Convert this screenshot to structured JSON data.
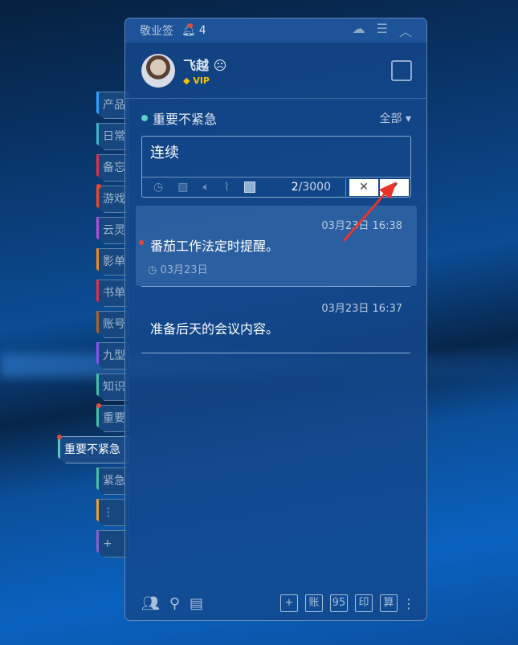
{
  "sidebar": {
    "tabs": [
      {
        "label": "产品",
        "color": "#2fa0ff"
      },
      {
        "label": "日常",
        "color": "#3fb5c7"
      },
      {
        "label": "备忘",
        "color": "#e0304a"
      },
      {
        "label": "游戏",
        "color": "#e84a2a",
        "badge": true
      },
      {
        "label": "云灵",
        "color": "#b050d8"
      },
      {
        "label": "影单",
        "color": "#f08a20"
      },
      {
        "label": "书单",
        "color": "#e0304a"
      },
      {
        "label": "账号",
        "color": "#b0602a"
      },
      {
        "label": "九型",
        "color": "#8a50f0"
      },
      {
        "label": "知识",
        "color": "#45c0a8"
      },
      {
        "label": "重要",
        "color": "#45c0a8",
        "badge": true
      },
      {
        "label": "重要不紧急",
        "color": "#5ec3c0",
        "badge": true,
        "active": true
      },
      {
        "label": "紧急",
        "color": "#45c0a8"
      },
      {
        "label": "⋮",
        "color": "#f0a030"
      },
      {
        "label": "+",
        "color": "#8a60d0"
      }
    ]
  },
  "titlebar": {
    "app_name": "敬业签",
    "reminder_count": "4"
  },
  "user": {
    "name": "飞越",
    "badge": "VIP"
  },
  "category": {
    "name": "重要不紧急",
    "filter": "全部"
  },
  "editor": {
    "text": "连续",
    "count_current": "2",
    "count_max": "/3000"
  },
  "notes": [
    {
      "time": "03月23日 16:38",
      "text": "番茄工作法定时提醒。",
      "reminder": "03月23日"
    },
    {
      "time": "03月23日 16:37",
      "text": "准备后天的会议内容。"
    }
  ],
  "footer": {
    "buttons": [
      "+",
      "账",
      "95",
      "印",
      "算"
    ]
  }
}
